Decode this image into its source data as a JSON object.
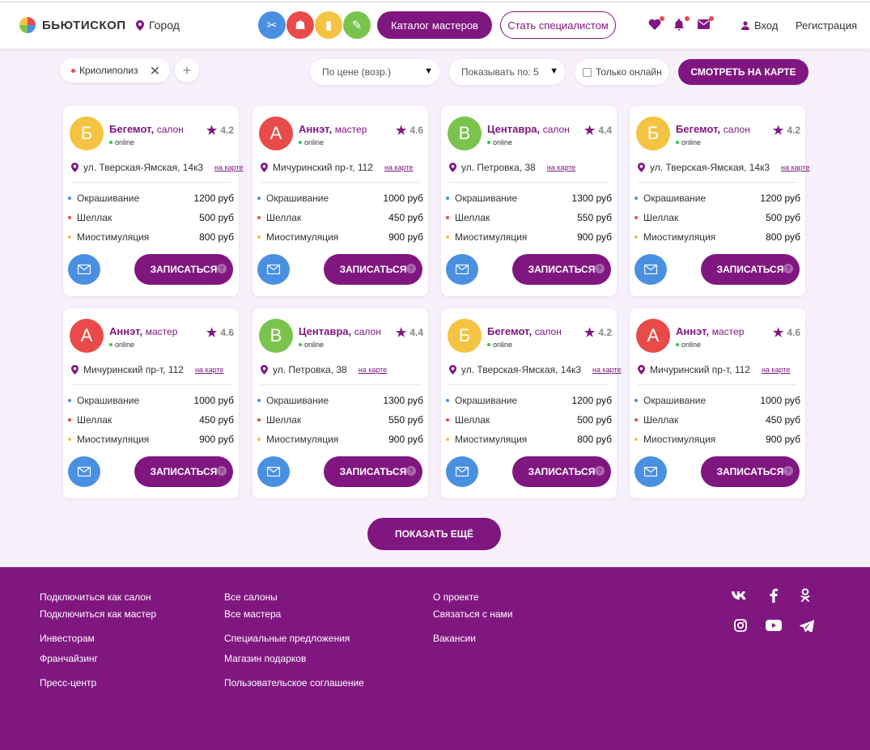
{
  "header": {
    "logo_text": "БЬЮТИСКОП",
    "city": "Город",
    "categories": [
      {
        "icon": "hair-dryer-icon",
        "color": "#4a90e2",
        "glyph": "✂"
      },
      {
        "icon": "cake-icon",
        "color": "#e94b4b",
        "glyph": "☗"
      },
      {
        "icon": "nail-polish-icon",
        "color": "#f5c342",
        "glyph": "▮"
      },
      {
        "icon": "spray-icon",
        "color": "#7ac44e",
        "glyph": "✎"
      }
    ],
    "catalog_label": "Каталог мастеров",
    "become_specialist_label": "Стать специалистом",
    "login_label": "Вход",
    "register_label": "Регистрация"
  },
  "filters": {
    "chip_label": "Криолиполиз",
    "sort_label": "По цене (возр.)",
    "per_page_label": "Показывать по: 5",
    "online_only_label": "Только онлайн",
    "map_button_label": "СМОТРЕТЬ НА КАРТЕ"
  },
  "card_common": {
    "online_label": "online",
    "map_link_label": "на карте",
    "book_label": "ЗАПИСАТЬСЯ",
    "help_glyph": "?",
    "service_dot_colors": [
      "#4a90e2",
      "#e94b4b",
      "#f5c342"
    ]
  },
  "cards": [
    {
      "letter": "Б",
      "color": "#f5c342",
      "name": "Бегемот",
      "type": "салон",
      "rating": "4.2",
      "address": "ул. Тверская-Ямская, 14к3",
      "services": [
        {
          "name": "Окрашивание",
          "price": "1200 руб"
        },
        {
          "name": "Шеллак",
          "price": "500 руб"
        },
        {
          "name": "Миостимуляция",
          "price": "800 руб"
        }
      ]
    },
    {
      "letter": "А",
      "color": "#e94b4b",
      "name": "Аннэт",
      "type": "мастер",
      "rating": "4.6",
      "address": "Мичуринский пр-т, 112",
      "services": [
        {
          "name": "Окрашивание",
          "price": "1000 руб"
        },
        {
          "name": "Шеллак",
          "price": "450 руб"
        },
        {
          "name": "Миостимуляция",
          "price": "900 руб"
        }
      ]
    },
    {
      "letter": "В",
      "color": "#7ac44e",
      "name": "Центавра",
      "type": "салон",
      "rating": "4.4",
      "address": "ул. Петровка, 38",
      "services": [
        {
          "name": "Окрашивание",
          "price": "1300 руб"
        },
        {
          "name": "Шеллак",
          "price": "550 руб"
        },
        {
          "name": "Миостимуляция",
          "price": "900 руб"
        }
      ]
    },
    {
      "letter": "Б",
      "color": "#f5c342",
      "name": "Бегемот",
      "type": "салон",
      "rating": "4.2",
      "address": "ул. Тверская-Ямская, 14к3",
      "services": [
        {
          "name": "Окрашивание",
          "price": "1200 руб"
        },
        {
          "name": "Шеллак",
          "price": "500 руб"
        },
        {
          "name": "Миостимуляция",
          "price": "800 руб"
        }
      ]
    },
    {
      "letter": "А",
      "color": "#e94b4b",
      "name": "Аннэт",
      "type": "мастер",
      "rating": "4.6",
      "address": "Мичуринский пр-т, 112",
      "services": [
        {
          "name": "Окрашивание",
          "price": "1000 руб"
        },
        {
          "name": "Шеллак",
          "price": "450 руб"
        },
        {
          "name": "Миостимуляция",
          "price": "900 руб"
        }
      ]
    },
    {
      "letter": "В",
      "color": "#7ac44e",
      "name": "Центавра",
      "type": "салон",
      "rating": "4.4",
      "address": "ул. Петровка, 38",
      "services": [
        {
          "name": "Окрашивание",
          "price": "1300 руб"
        },
        {
          "name": "Шеллак",
          "price": "550 руб"
        },
        {
          "name": "Миостимуляция",
          "price": "900 руб"
        }
      ]
    },
    {
      "letter": "Б",
      "color": "#f5c342",
      "name": "Бегемот",
      "type": "салон",
      "rating": "4.2",
      "address": "ул. Тверская-Ямская, 14к3",
      "services": [
        {
          "name": "Окрашивание",
          "price": "1200 руб"
        },
        {
          "name": "Шеллак",
          "price": "500 руб"
        },
        {
          "name": "Миостимуляция",
          "price": "800 руб"
        }
      ]
    },
    {
      "letter": "А",
      "color": "#e94b4b",
      "name": "Аннэт",
      "type": "мастер",
      "rating": "4.6",
      "address": "Мичуринский пр-т, 112",
      "services": [
        {
          "name": "Окрашивание",
          "price": "1000 руб"
        },
        {
          "name": "Шеллак",
          "price": "450 руб"
        },
        {
          "name": "Миостимуляция",
          "price": "900 руб"
        }
      ]
    }
  ],
  "show_more_label": "ПОКАЗАТЬ ЕЩЁ",
  "footer": {
    "col1": [
      "Подключиться как салон",
      "Подключиться как мастер",
      "Инвесторам",
      "Франчайзинг",
      "Пресс-центр"
    ],
    "col2": [
      "Все салоны",
      "Все мастера",
      "Специальные предложения",
      "Магазин подарков",
      "Пользовательское соглашение"
    ],
    "col3": [
      "О проекте",
      "Связаться с нами",
      "Вакансии"
    ],
    "social": [
      "vk-icon",
      "facebook-icon",
      "odnoklassniki-icon",
      "instagram-icon",
      "youtube-icon",
      "telegram-icon"
    ]
  },
  "colors": {
    "brand": "#801780",
    "background": "#f8f1fb"
  }
}
